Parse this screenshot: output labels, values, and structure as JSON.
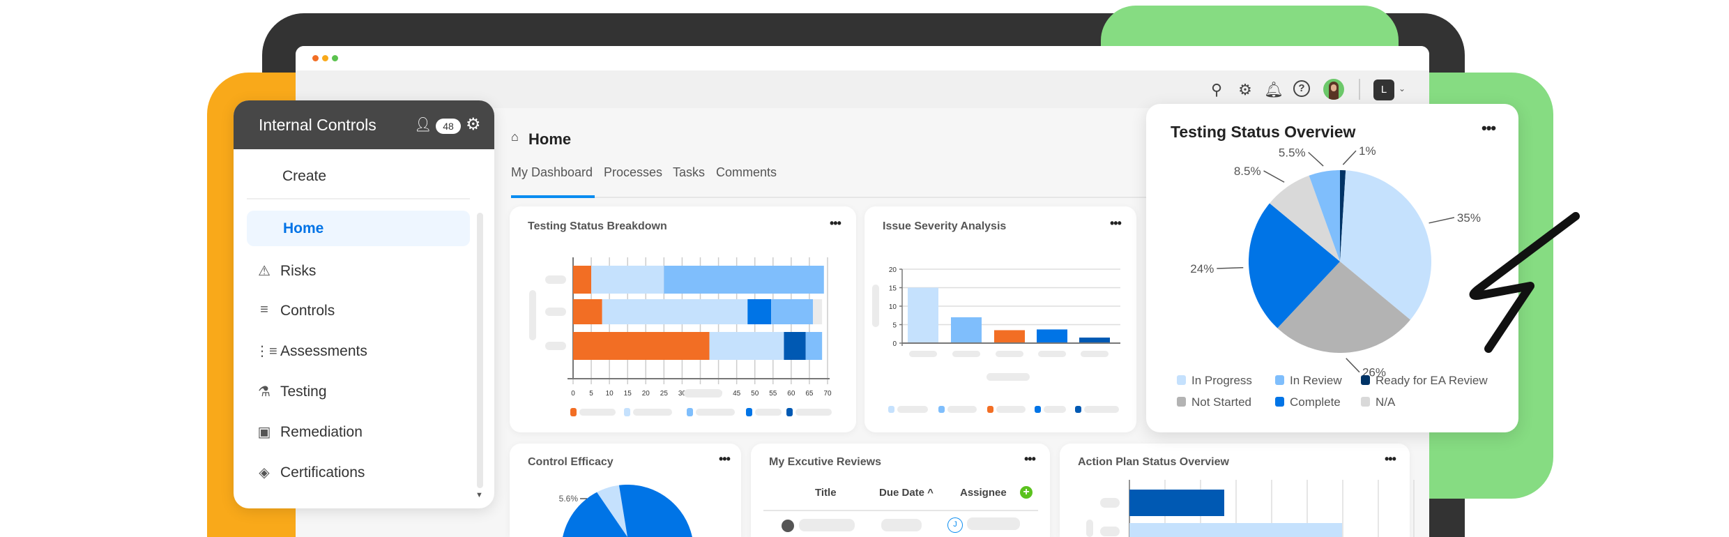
{
  "app": {
    "title": "Internal Controls",
    "notification_count": "48",
    "user_initial": "L"
  },
  "toolbar": {
    "icons": [
      "search-icon",
      "gear-icon",
      "bell-icon",
      "help-icon",
      "avatar",
      "account-menu"
    ]
  },
  "sidebar": {
    "create_label": "Create",
    "items": [
      {
        "label": "Home",
        "icon": "home",
        "active": true
      },
      {
        "label": "Risks",
        "icon": "warning-icon"
      },
      {
        "label": "Controls",
        "icon": "sliders-icon"
      },
      {
        "label": "Assessments",
        "icon": "list-icon"
      },
      {
        "label": "Testing",
        "icon": "flask-icon"
      },
      {
        "label": "Remediation",
        "icon": "clipboard-alert-icon"
      },
      {
        "label": "Certifications",
        "icon": "certificate-icon"
      }
    ]
  },
  "page": {
    "title": "Home",
    "tabs": [
      {
        "label": "My Dashboard",
        "active": true
      },
      {
        "label": "Processes"
      },
      {
        "label": "Tasks"
      },
      {
        "label": "Comments"
      }
    ]
  },
  "colors": {
    "orange": "#F26E24",
    "light_blue": "#C5E1FD",
    "mid_blue": "#7FBEFC",
    "blue": "#0074E6",
    "dark_blue": "#0059B3",
    "navy": "#003366",
    "gray": "#B3B3B3",
    "light_gray": "#D9D9D9"
  },
  "cards": {
    "testing_breakdown": {
      "title": "Testing Status Breakdown"
    },
    "issue_severity": {
      "title": "Issue Severity Analysis"
    },
    "overview": {
      "title": "Testing Status Overview"
    },
    "control_efficacy": {
      "title": "Control Efficacy"
    },
    "exec_reviews": {
      "title": "My Excutive Reviews",
      "columns": [
        "Title",
        "Due Date ^",
        "Assignee"
      ],
      "row_assignee_initial": "J"
    },
    "action_plan": {
      "title": "Action Plan Status Overview"
    }
  },
  "chart_data": [
    {
      "type": "bar",
      "orientation": "horizontal",
      "stacked": true,
      "xlim": [
        0,
        70
      ],
      "xticks": [
        "0",
        "5",
        "10",
        "15",
        "20",
        "25",
        "30",
        "35",
        "40",
        "45",
        "50",
        "55",
        "60",
        "65",
        "70"
      ],
      "rows": [
        [
          {
            "color": "#F26E24",
            "value": 5
          },
          {
            "color": "#C5E1FD",
            "value": 20
          },
          {
            "color": "#7FBEFC",
            "value": 44
          }
        ],
        [
          {
            "color": "#F26E24",
            "value": 8
          },
          {
            "color": "#C5E1FD",
            "value": 40
          },
          {
            "color": "#0074E6",
            "value": 6.5
          },
          {
            "color": "#7FBEFC",
            "value": 11.5
          },
          {
            "color": "#EBEBEB",
            "value": 2.5
          }
        ],
        [
          {
            "color": "#F26E24",
            "value": 37.5
          },
          {
            "color": "#C5E1FD",
            "value": 20.5
          },
          {
            "color": "#0059B3",
            "value": 6
          },
          {
            "color": "#7FBEFC",
            "value": 4.5
          }
        ]
      ],
      "legend_colors": [
        "#F26E24",
        "#C5E1FD",
        "#7FBEFC",
        "#0074E6",
        "#0059B3"
      ]
    },
    {
      "type": "bar",
      "ylim": [
        0,
        20
      ],
      "yticks": [
        "0",
        "5",
        "10",
        "15",
        "20"
      ],
      "values": [
        15,
        7,
        3.5,
        3.7,
        1.5
      ],
      "colors": [
        "#C5E1FD",
        "#7FBEFC",
        "#F26E24",
        "#0074E6",
        "#0059B3"
      ]
    },
    {
      "type": "pie",
      "title": "Testing Status Overview",
      "slices": [
        {
          "name": "Ready for EA Review",
          "value": 1,
          "label": "1%",
          "color": "#003366"
        },
        {
          "name": "In Progress",
          "value": 35,
          "label": "35%",
          "color": "#C5E1FD"
        },
        {
          "name": "Not Started",
          "value": 26,
          "label": "26%",
          "color": "#B3B3B3"
        },
        {
          "name": "Complete",
          "value": 24,
          "label": "24%",
          "color": "#0074E6"
        },
        {
          "name": "N/A",
          "value": 8.5,
          "label": "8.5%",
          "color": "#D9D9D9"
        },
        {
          "name": "In Review",
          "value": 5.5,
          "label": "5.5%",
          "color": "#7FBEFC"
        }
      ],
      "legend": [
        "In Progress",
        "In Review",
        "Ready for EA Review",
        "Not Started",
        "Complete",
        "N/A"
      ]
    },
    {
      "type": "pie",
      "title": "Control Efficacy",
      "slices": [
        {
          "value": 5.6,
          "label": "5.6%",
          "color": "#C5E1FD"
        },
        {
          "value": 94.4,
          "color": "#0074E6"
        }
      ]
    },
    {
      "type": "bar",
      "orientation": "horizontal",
      "colors": [
        "#0059B3",
        "#C5E1FD"
      ]
    }
  ]
}
